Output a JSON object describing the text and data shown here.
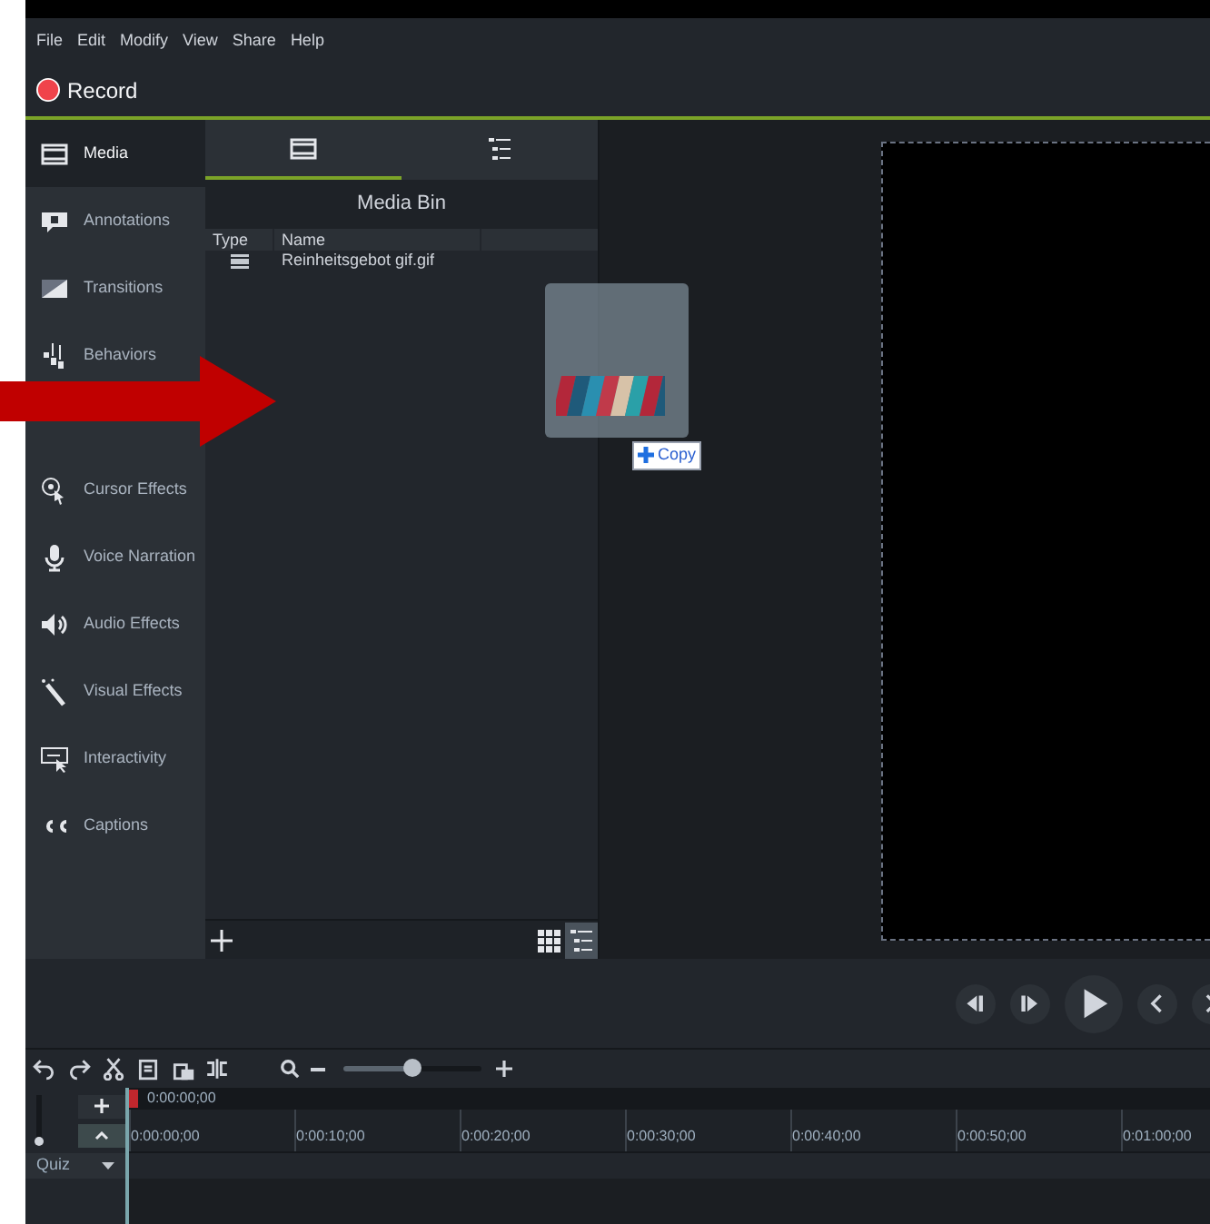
{
  "menu": [
    "File",
    "Edit",
    "Modify",
    "View",
    "Share",
    "Help"
  ],
  "record": {
    "label": "Record"
  },
  "sidebar": {
    "items": [
      {
        "label": "Media",
        "kind": "film",
        "selected": true
      },
      {
        "label": "Annotations",
        "kind": "annotation",
        "selected": false
      },
      {
        "label": "Transitions",
        "kind": "transition",
        "selected": false
      },
      {
        "label": "Behaviors",
        "kind": "behavior",
        "selected": false
      },
      {
        "label": "Cursor Effects",
        "kind": "cursor",
        "selected": false
      },
      {
        "label": "Voice Narration",
        "kind": "mic",
        "selected": false
      },
      {
        "label": "Audio Effects",
        "kind": "speaker",
        "selected": false
      },
      {
        "label": "Visual Effects",
        "kind": "wand",
        "selected": false
      },
      {
        "label": "Interactivity",
        "kind": "interactive",
        "selected": false
      },
      {
        "label": "Captions",
        "kind": "cc",
        "selected": false
      }
    ]
  },
  "media_bin": {
    "tabs": [
      {
        "kind": "film",
        "selected": true
      },
      {
        "kind": "list",
        "selected": false
      }
    ],
    "title": "Media Bin",
    "columns": [
      "Type",
      "Name"
    ],
    "rows": [
      {
        "name": "Reinheitsgebot gif.gif"
      }
    ],
    "views": [
      {
        "kind": "grid",
        "selected": false
      },
      {
        "kind": "list",
        "selected": true
      }
    ]
  },
  "drag": {
    "badge": "Copy"
  },
  "timeline": {
    "zoom": {
      "level": 0.5
    },
    "track_height": {
      "level": 0
    },
    "playhead": "0:00:00;00",
    "ticks": [
      "0:00:00;00",
      "0:00:10;00",
      "0:00:20;00",
      "0:00:30;00",
      "0:00:40;00",
      "0:00:50;00",
      "0:01:00;00"
    ],
    "track": "Quiz"
  }
}
